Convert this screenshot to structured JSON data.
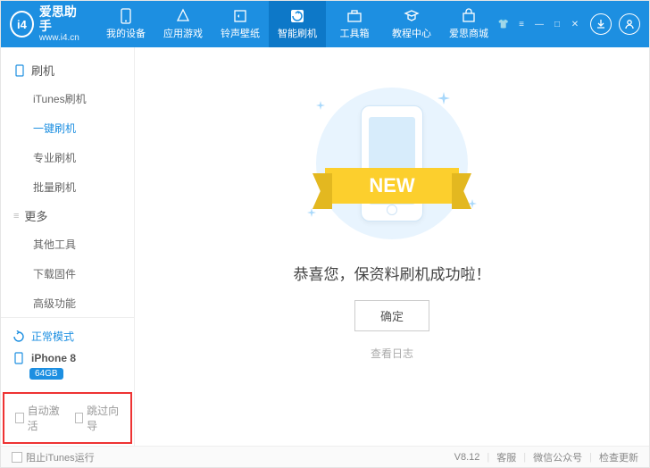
{
  "brand": {
    "title": "爱思助手",
    "subtitle": "www.i4.cn",
    "logo_text": "i4"
  },
  "nav": [
    {
      "key": "device",
      "label": "我的设备"
    },
    {
      "key": "apps",
      "label": "应用游戏"
    },
    {
      "key": "ringtone",
      "label": "铃声壁纸"
    },
    {
      "key": "flash",
      "label": "智能刷机"
    },
    {
      "key": "toolbox",
      "label": "工具箱"
    },
    {
      "key": "tutorial",
      "label": "教程中心"
    },
    {
      "key": "mall",
      "label": "爱思商城"
    }
  ],
  "nav_active": 3,
  "sidebar": {
    "groups": [
      {
        "title": "刷机",
        "items": [
          {
            "key": "itunes_flash",
            "label": "iTunes刷机"
          },
          {
            "key": "oneclick_flash",
            "label": "一键刷机",
            "active": true
          },
          {
            "key": "pro_flash",
            "label": "专业刷机"
          },
          {
            "key": "batch_flash",
            "label": "批量刷机"
          }
        ]
      },
      {
        "title": "更多",
        "items": [
          {
            "key": "other_tools",
            "label": "其他工具"
          },
          {
            "key": "download_fw",
            "label": "下载固件"
          },
          {
            "key": "advanced",
            "label": "高级功能"
          }
        ]
      }
    ],
    "mode": "正常模式",
    "device": {
      "name": "iPhone 8",
      "storage": "64GB"
    }
  },
  "options": {
    "auto_activate": "自动激活",
    "skip_guide": "跳过向导"
  },
  "main": {
    "ribbon": "NEW",
    "message": "恭喜您，保资料刷机成功啦！",
    "confirm": "确定",
    "view_log": "查看日志"
  },
  "footer": {
    "block_itunes": "阻止iTunes运行",
    "version": "V8.12",
    "support": "客服",
    "wechat": "微信公众号",
    "update": "检查更新"
  }
}
